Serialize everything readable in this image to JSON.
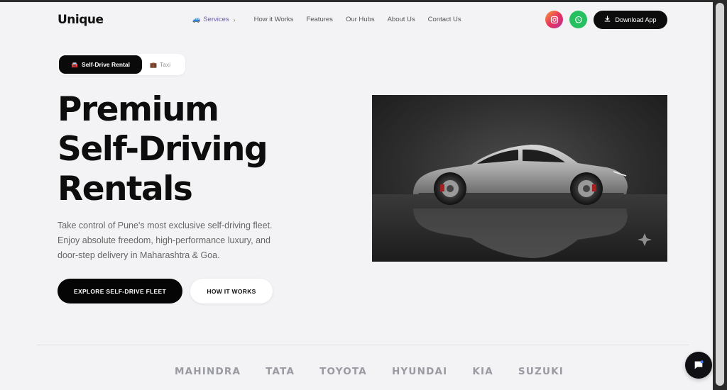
{
  "brand": {
    "logo_text": "Unique"
  },
  "nav": {
    "items": [
      {
        "label": "Services",
        "icon": "car-icon",
        "has_chevron": true
      },
      {
        "label": "How it Works"
      },
      {
        "label": "Features"
      },
      {
        "label": "Our Hubs"
      },
      {
        "label": "About Us"
      },
      {
        "label": "Contact Us"
      }
    ],
    "download_label": "Download App"
  },
  "toggle": {
    "active_label": "Self-Drive Rental",
    "inactive_label": "Taxi"
  },
  "hero": {
    "headline_lines": [
      "Premium",
      "Self-Driving",
      "Rentals"
    ],
    "subtext": "Take control of Pune's most exclusive self-driving fleet. Enjoy absolute freedom, high-performance luxury, and door-step delivery in Maharashtra & Goa.",
    "primary_cta": "EXPLORE SELF-DRIVE FLEET",
    "secondary_cta": "HOW IT WORKS"
  },
  "brands": [
    "MAHINDRA",
    "TATA",
    "TOYOTA",
    "HYUNDAI",
    "KIA",
    "SUZUKI"
  ],
  "colors": {
    "background": "#f3f3f5",
    "primary": "#050505",
    "instagram": "#e9345b",
    "whatsapp": "#27c060",
    "brand_text": "#9a9aa3"
  }
}
